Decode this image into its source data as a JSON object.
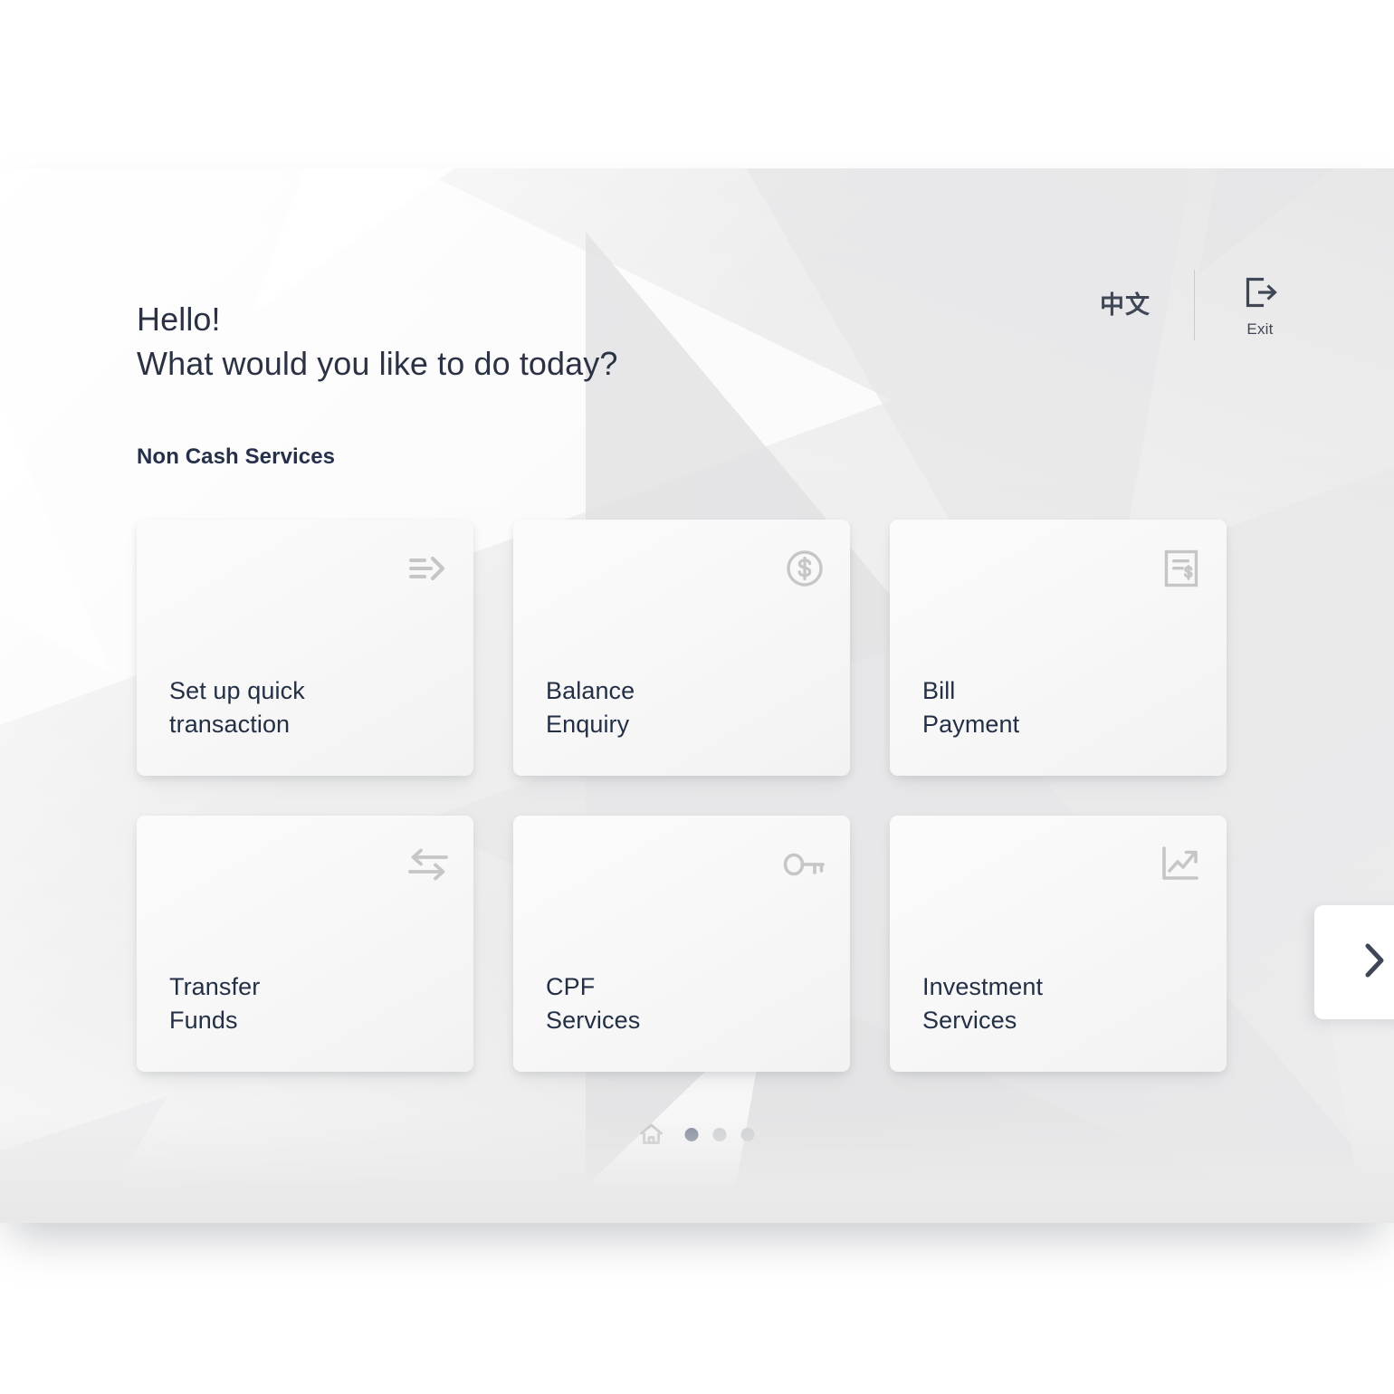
{
  "screen": {
    "greeting_line1": "Hello!",
    "greeting_line2": "What would you like to do today?",
    "section_title": "Non Cash Services"
  },
  "top_bar": {
    "language_label": "中文",
    "exit_label": "Exit",
    "exit_icon": "exit-door-arrow-icon",
    "divider": "vertical-divider"
  },
  "services": [
    {
      "line1": "Set up quick",
      "line2": "transaction",
      "icon": "quick-transaction-arrow-icon"
    },
    {
      "line1": "Balance",
      "line2": "Enquiry",
      "icon": "dollar-coin-icon"
    },
    {
      "line1": "Bill",
      "line2": "Payment",
      "icon": "invoice-dollar-icon"
    },
    {
      "line1": "Transfer",
      "line2": "Funds",
      "icon": "transfer-exchange-arrows-icon"
    },
    {
      "line1": "CPF",
      "line2": "Services",
      "icon": "key-icon"
    },
    {
      "line1": "Investment",
      "line2": "Services",
      "icon": "growth-chart-icon"
    }
  ],
  "pager": {
    "home_icon": "home-icon",
    "dots": 3,
    "active_index": 0
  },
  "next_page": {
    "icon": "chevron-right-icon"
  },
  "colors": {
    "heading_text": "#2a3243",
    "section_title": "#26304a",
    "card_text": "#232f45",
    "card_icon": "#c6c6c6",
    "accent_dark": "#3f4757",
    "pager_active": "#7b8596",
    "pager_inactive": "#cdcfd2",
    "panel_bg": "#ececec"
  }
}
